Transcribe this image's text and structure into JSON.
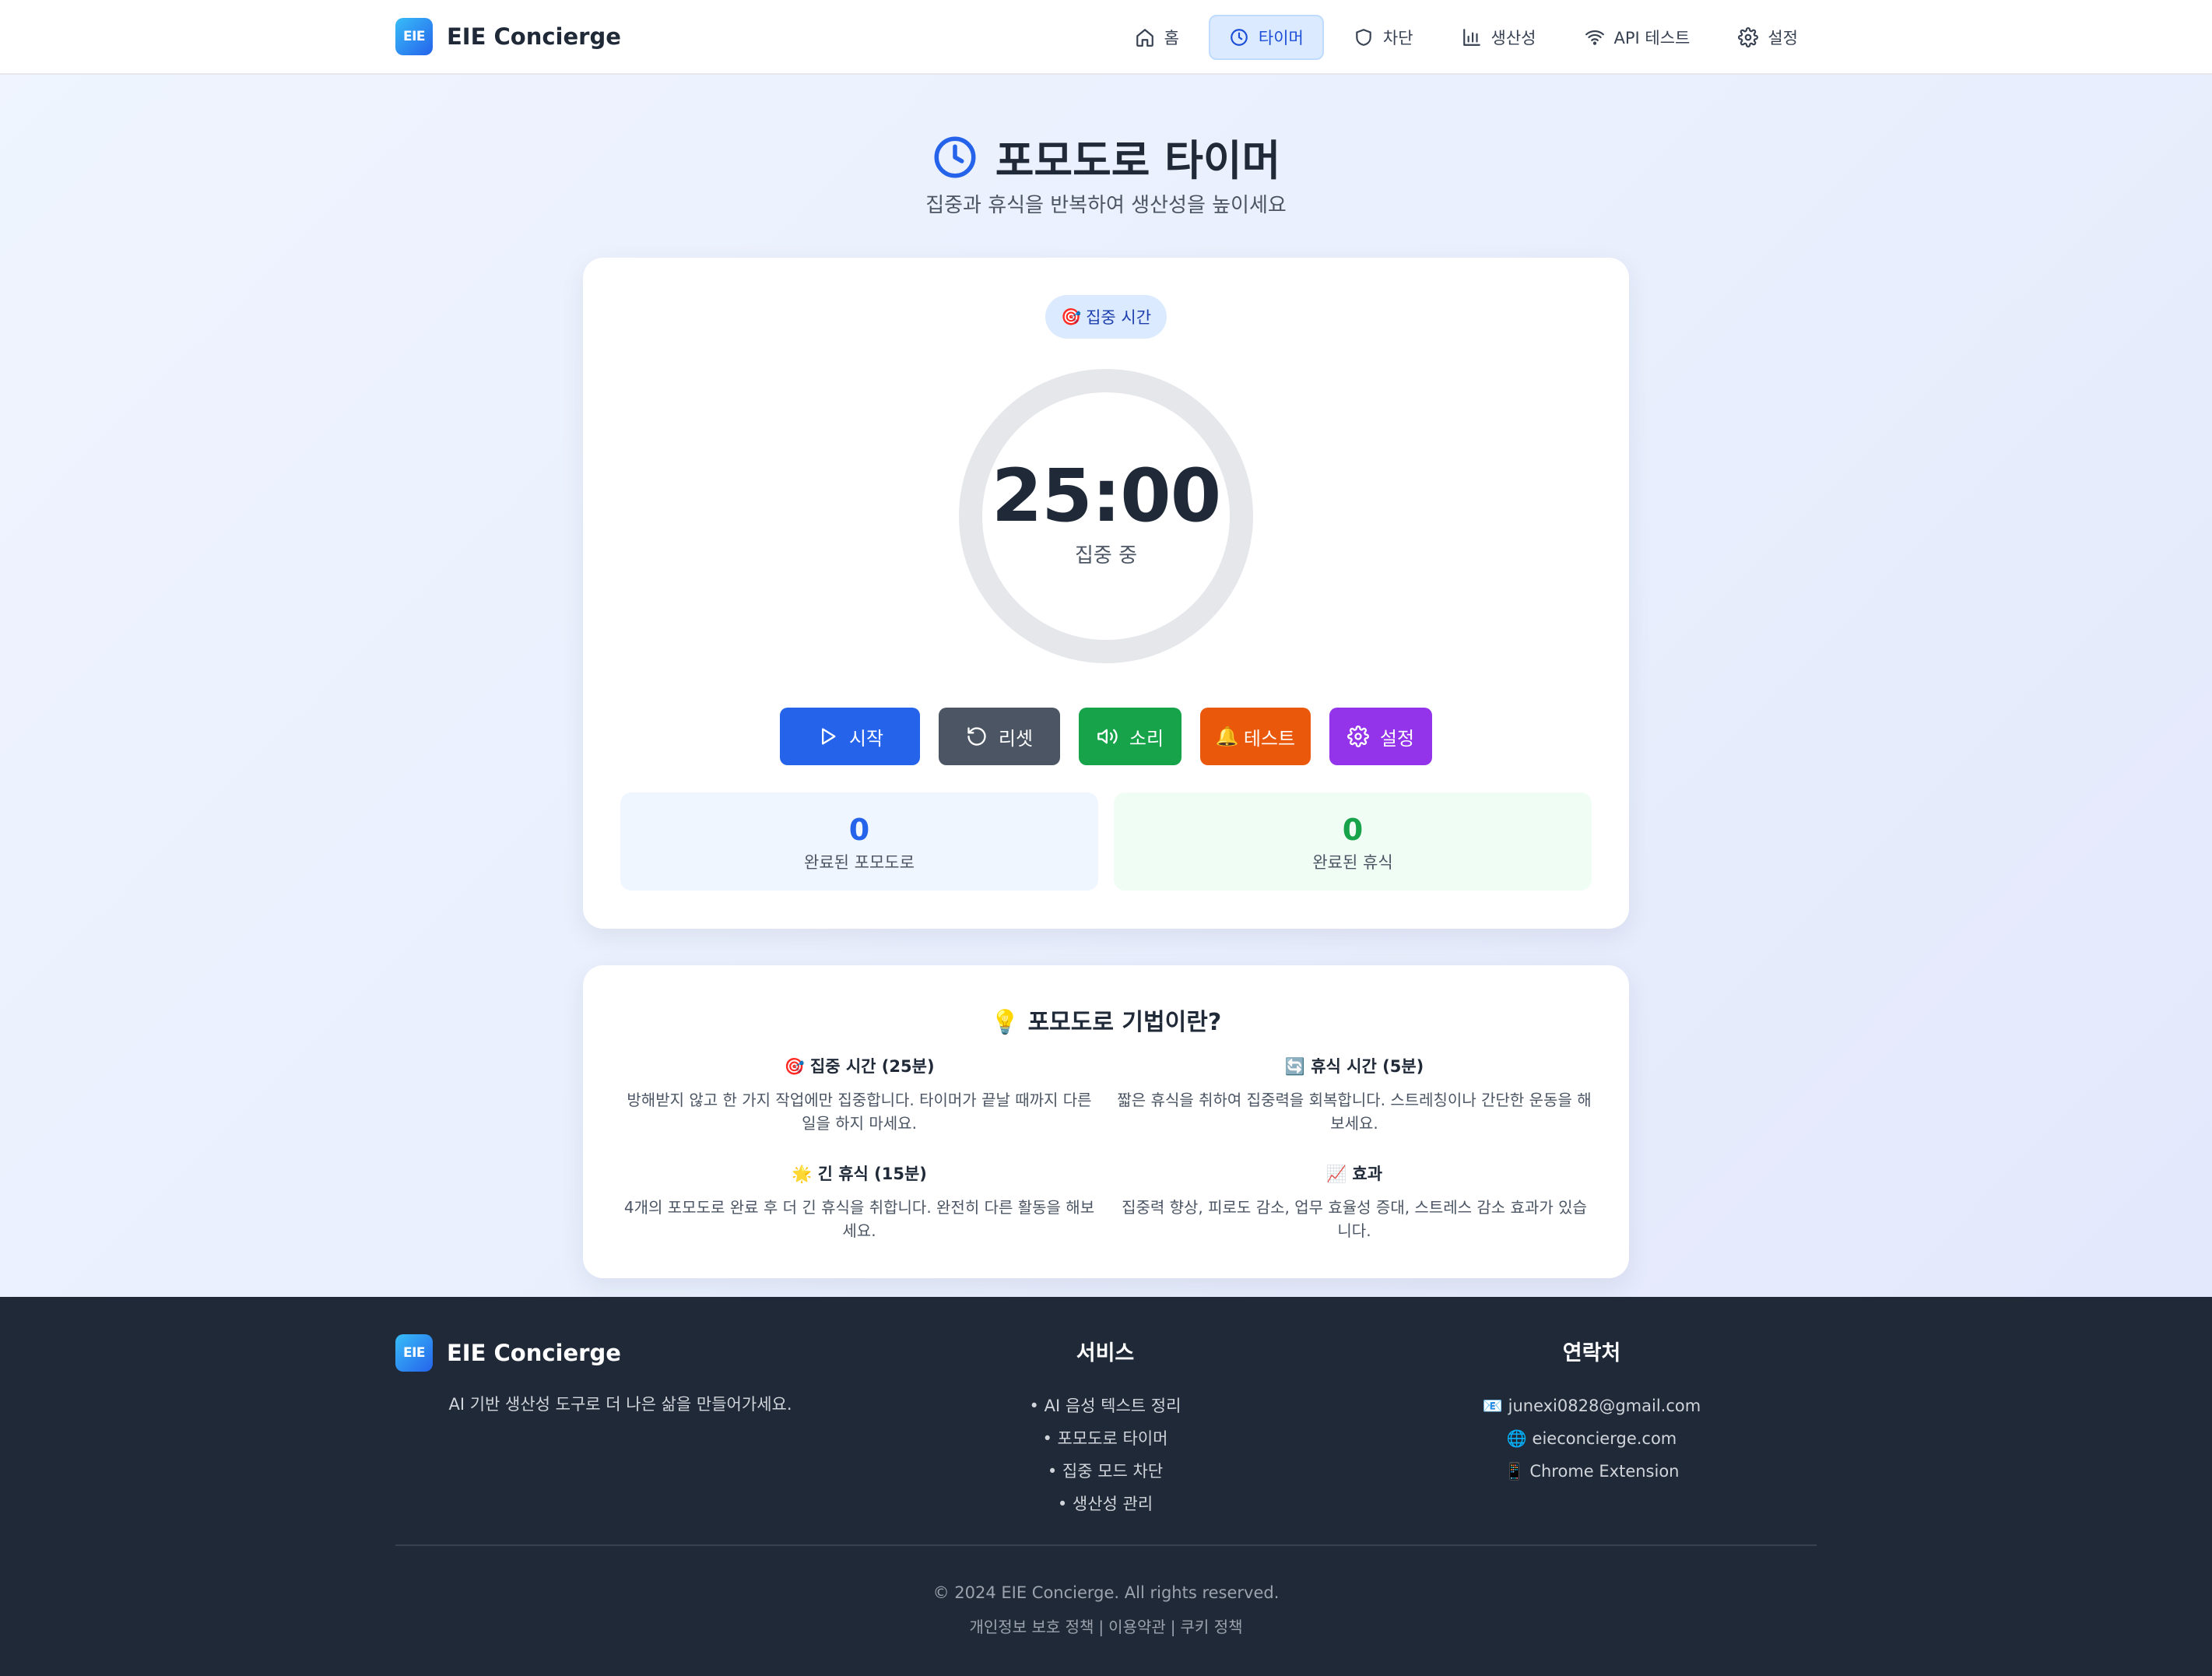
{
  "brand": {
    "logo_text": "EIE",
    "name": "EIE Concierge"
  },
  "nav": {
    "items": [
      {
        "label": "홈",
        "icon": "home-icon",
        "active": false
      },
      {
        "label": "타이머",
        "icon": "clock-icon",
        "active": true
      },
      {
        "label": "차단",
        "icon": "shield-icon",
        "active": false
      },
      {
        "label": "생산성",
        "icon": "bar-chart-icon",
        "active": false
      },
      {
        "label": "API 테스트",
        "icon": "wifi-icon",
        "active": false
      },
      {
        "label": "설정",
        "icon": "gear-icon",
        "active": false
      }
    ]
  },
  "hero": {
    "title": "포모도로 타이머",
    "subtitle": "집중과 휴식을 반복하여 생산성을 높이세요"
  },
  "timer": {
    "mode_emoji": "🎯",
    "mode_label": "집중 시간",
    "time": "25:00",
    "state": "집중 중",
    "progress": 0
  },
  "buttons": {
    "start": "시작",
    "reset": "리셋",
    "sound": "소리",
    "test_emoji": "🔔",
    "test": "테스트",
    "settings": "설정"
  },
  "stats": {
    "pomodoros_count": "0",
    "pomodoros_label": "완료된 포모도로",
    "breaks_count": "0",
    "breaks_label": "완료된 휴식"
  },
  "info": {
    "title_emoji": "💡",
    "title": "포모도로 기법이란?",
    "items": [
      {
        "emoji": "🎯",
        "title": "집중 시간 (25분)",
        "text": "방해받지 않고 한 가지 작업에만 집중합니다. 타이머가 끝날 때까지 다른 일을 하지 마세요."
      },
      {
        "emoji": "🔄",
        "title": "휴식 시간 (5분)",
        "text": "짧은 휴식을 취하여 집중력을 회복합니다. 스트레칭이나 간단한 운동을 해보세요."
      },
      {
        "emoji": "🌟",
        "title": "긴 휴식 (15분)",
        "text": "4개의 포모도로 완료 후 더 긴 휴식을 취합니다. 완전히 다른 활동을 해보세요."
      },
      {
        "emoji": "📈",
        "title": "효과",
        "text": "집중력 향상, 피로도 감소, 업무 효율성 증대, 스트레스 감소 효과가 있습니다."
      }
    ]
  },
  "footer": {
    "tagline": "AI 기반 생산성 도구로 더 나은 삶을 만들어가세요.",
    "services_title": "서비스",
    "services": [
      "• AI 음성 텍스트 정리",
      "• 포모도로 타이머",
      "• 집중 모드 차단",
      "• 생산성 관리"
    ],
    "contact_title": "연락처",
    "contacts": [
      "📧 junexi0828@gmail.com",
      "🌐 eieconcierge.com",
      "📱 Chrome Extension"
    ],
    "copyright": "© 2024 EIE Concierge. All rights reserved.",
    "links": [
      "개인정보 보호 정책",
      "이용약관",
      "쿠키 정책"
    ]
  },
  "colors": {
    "primary": "#2563eb",
    "reset": "#4b5563",
    "sound": "#16a34a",
    "test": "#ea580c",
    "settings": "#9333ea",
    "footer_bg": "#1f2937",
    "ring_track": "#e5e7eb"
  }
}
